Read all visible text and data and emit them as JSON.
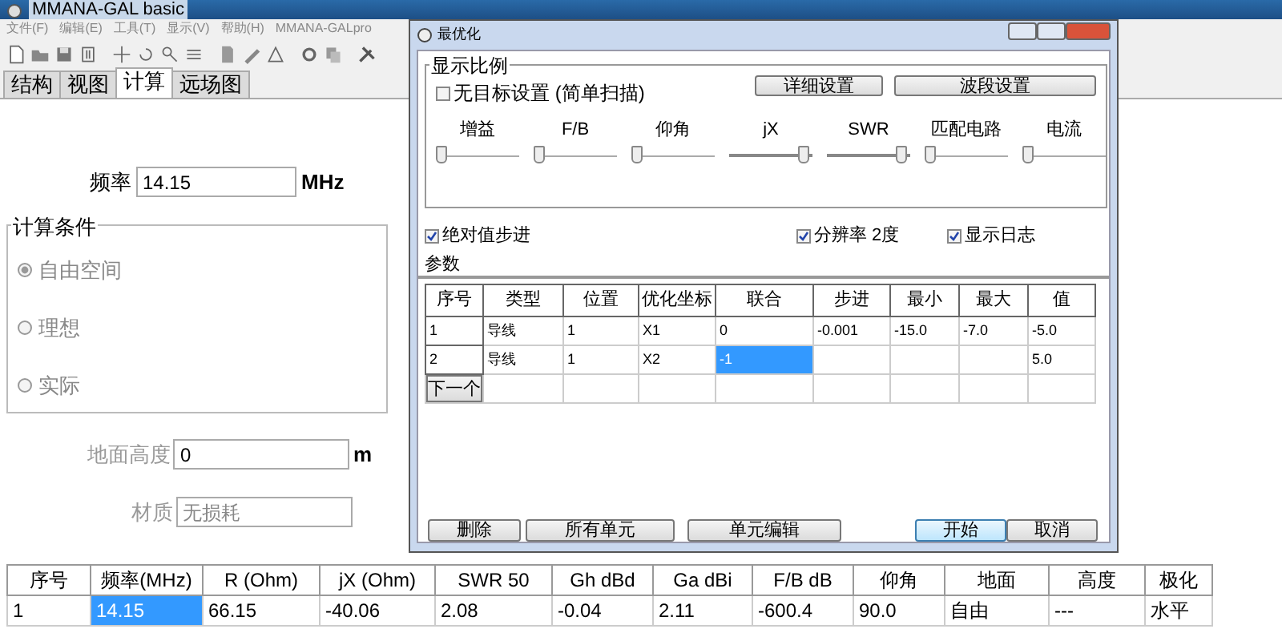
{
  "main_window": {
    "title": "MMANA-GAL basic",
    "menu": [
      "文件(F)",
      "编辑(E)",
      "工具(T)",
      "显示(V)",
      "帮助(H)",
      "MMANA-GALpro"
    ],
    "tabs": [
      {
        "label": "结构",
        "selected": false
      },
      {
        "label": "视图",
        "selected": false
      },
      {
        "label": "计算",
        "selected": true
      },
      {
        "label": "远场图",
        "selected": false
      }
    ]
  },
  "calculation": {
    "frequency_label": "频率",
    "frequency": "14.15",
    "frequency_unit": "MHz",
    "conditions_title": "计算条件",
    "conditions": [
      {
        "label": "自由空间",
        "selected": true
      },
      {
        "label": "理想",
        "selected": false
      },
      {
        "label": "实际",
        "selected": false
      }
    ],
    "ground_height": {
      "label": "地面高度",
      "value": "0",
      "unit": "m",
      "disabled": true
    },
    "material": {
      "label": "材质",
      "value": "无损耗",
      "disabled": true
    }
  },
  "dialog": {
    "title": "最优化",
    "scale_title": "显示比例",
    "no_target": {
      "label": "无目标设置 (简单扫描)",
      "checked": false
    },
    "top_buttons": [
      "详细设置",
      "波段设置"
    ],
    "sliders": [
      {
        "label": "增益",
        "level": 0
      },
      {
        "label": "F/B",
        "level": 0
      },
      {
        "label": "仰角",
        "level": 0
      },
      {
        "label": "jX",
        "level": 1
      },
      {
        "label": "SWR",
        "level": 1
      },
      {
        "label": "匹配电路",
        "level": 0
      },
      {
        "label": "电流",
        "level": 0
      }
    ],
    "options": [
      {
        "label": "绝对值步进",
        "checked": true
      },
      {
        "label": "分辨率 2度",
        "checked": true
      },
      {
        "label": "显示日志",
        "checked": true
      }
    ],
    "params_label": "参数",
    "table": {
      "columns": [
        "序号",
        "类型",
        "位置",
        "优化坐标",
        "联合",
        "步进",
        "最小",
        "最大",
        "值"
      ],
      "rows": [
        [
          {
            "text": "1",
            "selected": false
          },
          {
            "text": "导线",
            "selected": false
          },
          {
            "text": "1",
            "selected": false
          },
          {
            "text": "X1",
            "selected": false
          },
          {
            "text": "0",
            "selected": false
          },
          {
            "text": "-0.001",
            "selected": false
          },
          {
            "text": "-15.0",
            "selected": false
          },
          {
            "text": "-7.0",
            "selected": false
          },
          {
            "text": "-5.0",
            "selected": false
          }
        ],
        [
          {
            "text": "2",
            "selected": false
          },
          {
            "text": "导线",
            "selected": false
          },
          {
            "text": "1",
            "selected": false
          },
          {
            "text": "X2",
            "selected": false
          },
          {
            "text": "-1",
            "selected": true
          },
          {
            "selected": false
          },
          {
            "selected": false
          },
          {
            "selected": false
          },
          {
            "text": "5.0",
            "selected": false
          }
        ]
      ],
      "next_label": "下一个"
    },
    "buttons": [
      {
        "label": "删除",
        "default": false
      },
      {
        "label": "所有单元",
        "default": false
      },
      {
        "label": "单元编辑",
        "default": false
      },
      {
        "label": "开始",
        "default": true
      },
      {
        "label": "取消",
        "default": false
      }
    ]
  },
  "results": {
    "columns": [
      "序号",
      "频率(MHz)",
      "R (Ohm)",
      "jX (Ohm)",
      "SWR 50",
      "Gh dBd",
      "Ga dBi",
      "F/B dB",
      "仰角",
      "地面",
      "高度",
      "极化"
    ],
    "rows": [
      [
        {
          "text": "1",
          "selected": false
        },
        {
          "text": "14.15",
          "selected": true
        },
        {
          "text": "66.15",
          "selected": false
        },
        {
          "text": "-40.06",
          "selected": false
        },
        {
          "text": "2.08",
          "selected": false
        },
        {
          "text": "-0.04",
          "selected": false
        },
        {
          "text": "2.11",
          "selected": false
        },
        {
          "text": "-600.4",
          "selected": false
        },
        {
          "text": "90.0",
          "selected": false
        },
        {
          "text": "自由",
          "selected": false
        },
        {
          "text": "---",
          "selected": false
        },
        {
          "text": "水平",
          "selected": false
        }
      ]
    ]
  }
}
